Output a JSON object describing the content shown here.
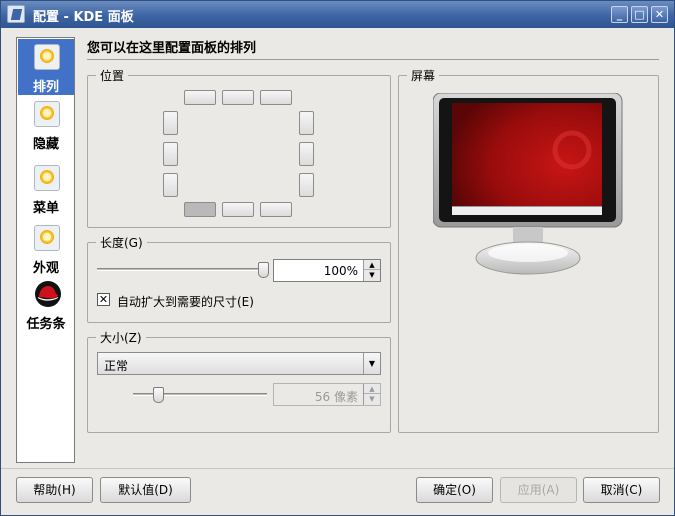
{
  "window": {
    "title": "配置 - KDE 面板",
    "minimize_label": "_",
    "maximize_label": "□",
    "close_label": "✕"
  },
  "sidebar": {
    "items": [
      {
        "label": "排列",
        "icon": "gear-sun-icon",
        "active": true
      },
      {
        "label": "隐藏",
        "icon": "gear-sun-icon",
        "active": false
      },
      {
        "label": "菜单",
        "icon": "gear-sun-icon",
        "active": false
      },
      {
        "label": "外观",
        "icon": "gear-sun-icon",
        "active": false
      },
      {
        "label": "任务条",
        "icon": "redhat-icon",
        "active": false
      }
    ]
  },
  "main": {
    "heading": "您可以在这里配置面板的排列",
    "position_group": {
      "title": "位置",
      "selected": "bottom-left"
    },
    "screen_group": {
      "title": "屏幕"
    },
    "length_group": {
      "title": "长度(G)",
      "slider_value": 1.0,
      "spin_value": "100%",
      "checkbox_checked": true,
      "checkbox_mark": "✕",
      "checkbox_label": "自动扩大到需要的尺寸(E)"
    },
    "size_group": {
      "title": "大小(Z)",
      "combo_value": "正常",
      "spin_value": "56 像素",
      "slider_value": 0.16
    }
  },
  "buttons": {
    "help": "帮助(H)",
    "defaults": "默认值(D)",
    "ok": "确定(O)",
    "apply": "应用(A)",
    "cancel": "取消(C)"
  },
  "colors": {
    "titlebar": "#3d64a3",
    "sidebar_active": "#4272c8",
    "wallpaper": "#a80d0d"
  }
}
